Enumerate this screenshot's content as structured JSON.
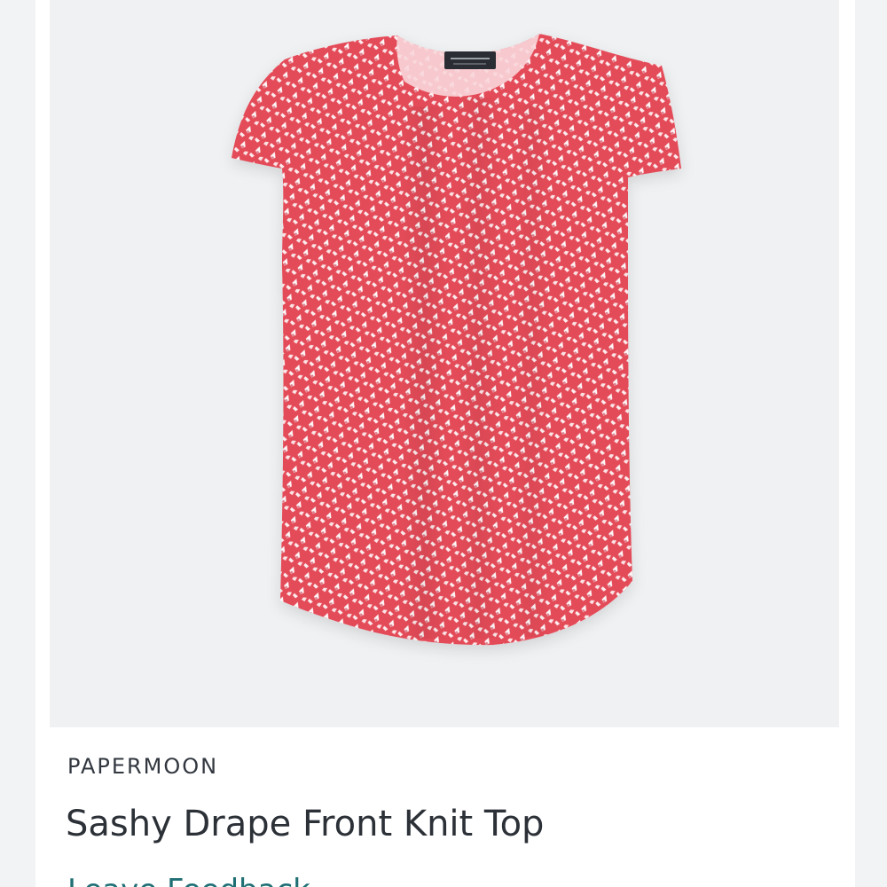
{
  "product": {
    "brand": "PAPERMOON",
    "title": "Sashy Drape Front Knit Top",
    "feedback_link": "Leave Feedback",
    "image_icon": "pink-geometric-print-top-image",
    "label_tag_icon": "brand-neck-label-icon"
  },
  "colors": {
    "page_background": "#f2f3f5",
    "card_background": "#ffffff",
    "image_background": "#eff1f3",
    "shirt_red": "#e44b59",
    "shirt_white": "#ffffff",
    "link_teal": "#1f6f74"
  }
}
